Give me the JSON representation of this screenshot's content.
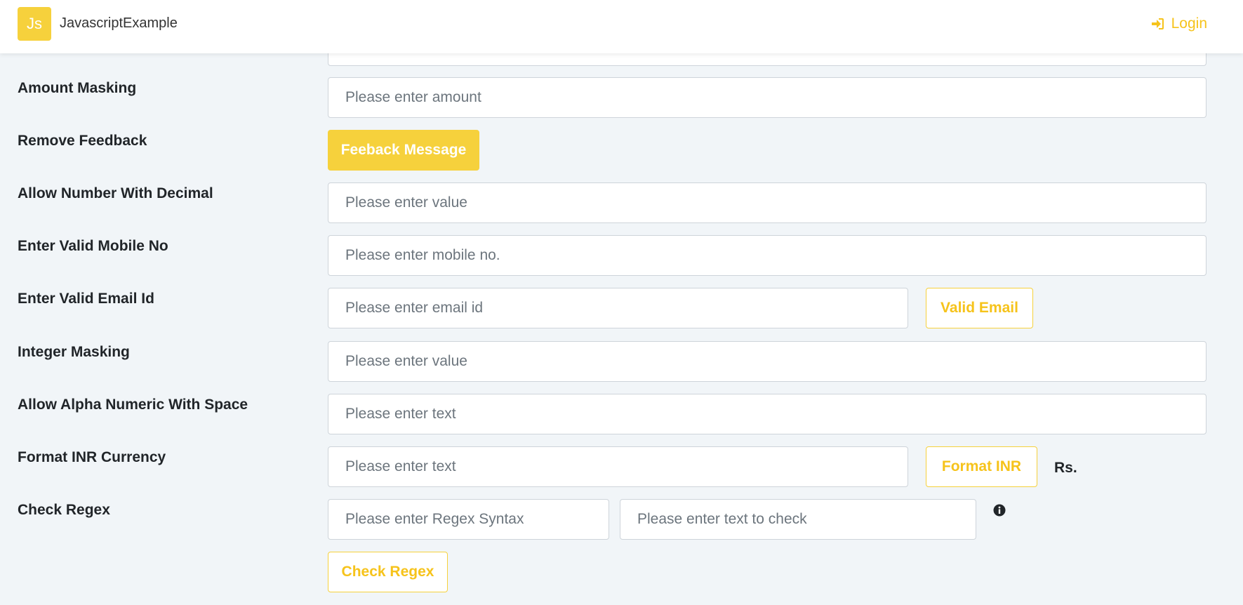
{
  "header": {
    "logo_text": "Js",
    "brand": "JavascriptExample",
    "login_label": "Login"
  },
  "colors": {
    "accent": "#f6d13c",
    "accent_text": "#f6c31b",
    "background": "#f1f5f8"
  },
  "rows": {
    "amount_masking": {
      "label": "Amount Masking",
      "placeholder": "Please enter amount"
    },
    "remove_feedback": {
      "label": "Remove Feedback",
      "button": "Feeback Message"
    },
    "decimal": {
      "label": "Allow Number With Decimal",
      "placeholder": "Please enter value"
    },
    "mobile": {
      "label": "Enter Valid Mobile No",
      "placeholder": "Please enter mobile no."
    },
    "email": {
      "label": "Enter Valid Email Id",
      "placeholder": "Please enter email id",
      "button": "Valid Email"
    },
    "integer": {
      "label": "Integer Masking",
      "placeholder": "Please enter value"
    },
    "alpha": {
      "label": "Allow Alpha Numeric With Space",
      "placeholder": "Please enter text"
    },
    "inr": {
      "label": "Format INR Currency",
      "placeholder": "Please enter text",
      "button": "Format INR",
      "result": "Rs."
    },
    "regex": {
      "label": "Check Regex",
      "syntax_placeholder": "Please enter Regex Syntax",
      "text_placeholder": "Please enter text to check",
      "button": "Check Regex",
      "info_icon": "info-circle-icon"
    }
  }
}
